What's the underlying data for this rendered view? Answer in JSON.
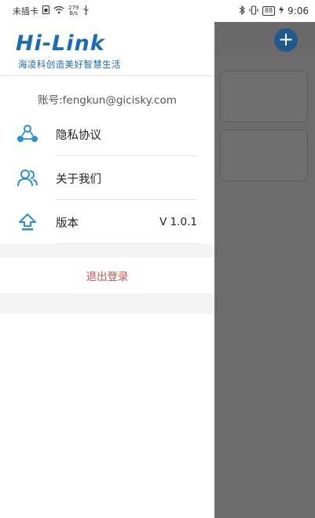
{
  "status_bar": {
    "carrier": "未插卡",
    "speed_value": "279",
    "speed_unit": "B/s",
    "battery": "88",
    "time": "9:06"
  },
  "drawer": {
    "logo_text": "Hi-Link",
    "logo_tagline": "海凌科创造美好智慧生活",
    "account_label": "账号:fengkun@gicisky.com",
    "menu": [
      {
        "label": "隐私协议",
        "icon": "share-nodes-icon"
      },
      {
        "label": "关于我们",
        "icon": "users-icon"
      },
      {
        "label": "版本",
        "icon": "upload-icon",
        "value": "V 1.0.1"
      }
    ],
    "logout_label": "退出登录"
  },
  "background": {
    "add_icon": "plus-icon"
  },
  "colors": {
    "brand": "#1a6cb3",
    "icon": "#2a8fd6",
    "logout": "#d9534f",
    "overlay": "#6c6c6c"
  }
}
